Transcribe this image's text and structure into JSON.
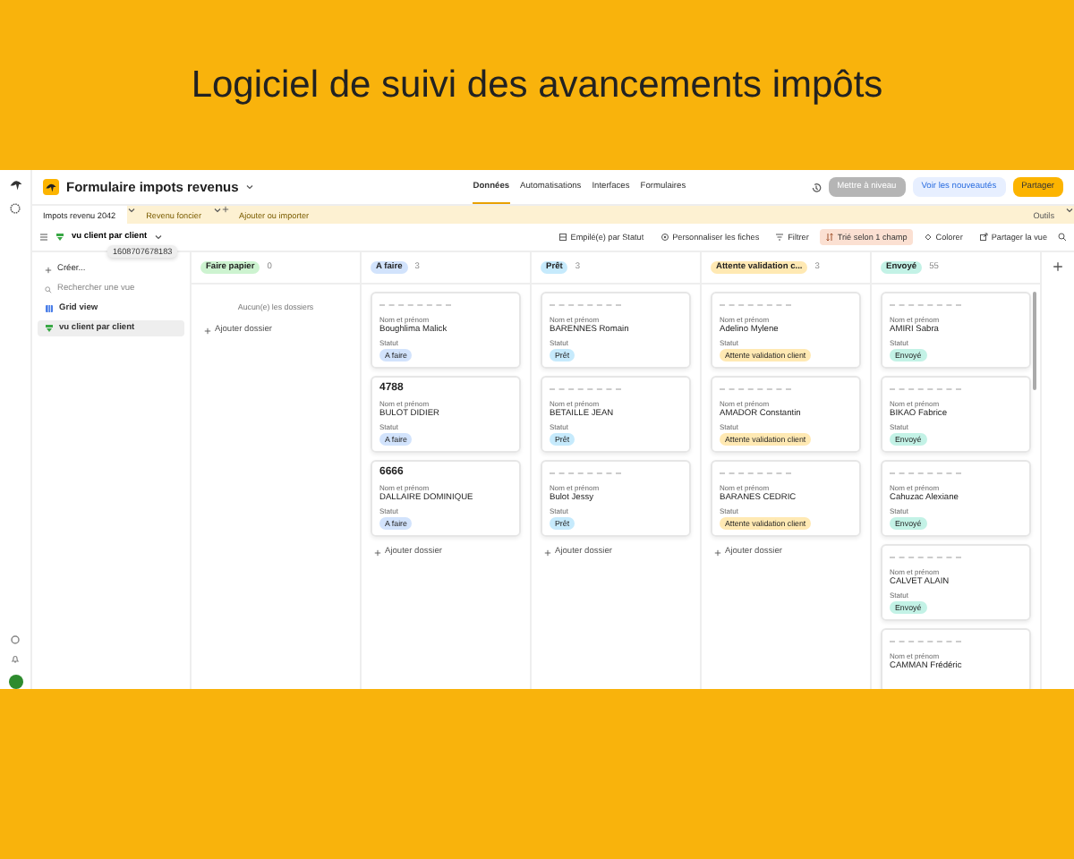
{
  "banner": {
    "title": "Logiciel de suivi des avancements impôts"
  },
  "app": {
    "base_title": "Formulaire impots revenus",
    "nav": [
      {
        "label": "Données",
        "selected": true
      },
      {
        "label": "Automatisations",
        "selected": false
      },
      {
        "label": "Interfaces",
        "selected": false
      },
      {
        "label": "Formulaires",
        "selected": false
      }
    ],
    "actions": [
      {
        "label": "Mettre à niveau",
        "kind": "upgrade"
      },
      {
        "label": "Voir les nouveautés",
        "kind": "news"
      },
      {
        "label": "Partager",
        "kind": "share"
      }
    ],
    "tables": [
      {
        "label": "Impots revenu 2042",
        "selected": true
      },
      {
        "label": "Revenu foncier",
        "selected": false
      }
    ],
    "add_table": "Ajouter ou importer",
    "tools": "Outils",
    "view": {
      "name": "vu client par client",
      "tooltip": "1608707678183"
    },
    "toolbar": [
      {
        "label": "Empilé(e) par Statut",
        "kind": "stack",
        "highlighted": false
      },
      {
        "label": "Personnaliser les fiches",
        "kind": "customize",
        "highlighted": false
      },
      {
        "label": "Filtrer",
        "kind": "filter",
        "highlighted": false
      },
      {
        "label": "Trié selon 1 champ",
        "kind": "sort",
        "highlighted": true
      },
      {
        "label": "Colorer",
        "kind": "color",
        "highlighted": false
      },
      {
        "label": "Partager la vue",
        "kind": "share",
        "highlighted": false
      }
    ],
    "sidebar": {
      "create": "Créer...",
      "search_placeholder": "Rechercher une vue",
      "views": [
        {
          "label": "Grid view",
          "kind": "grid",
          "selected": false
        },
        {
          "label": "vu client par client",
          "kind": "kanban",
          "selected": true
        }
      ]
    },
    "columns": [
      {
        "label": "Faire papier",
        "count": "0",
        "color": "#cdf3d0",
        "empty_text": "Aucun(e) les dossiers",
        "add_label": "Ajouter dossier"
      },
      {
        "label": "A faire",
        "count": "3",
        "color": "#d2e3fc",
        "add_label": "Ajouter dossier",
        "cards": [
          {
            "name_label": "Nom et prénom",
            "name": "Boughlima Malick",
            "status_label": "Statut",
            "status": "A faire"
          },
          {
            "title": "4788",
            "name_label": "Nom et prénom",
            "name": "BULOT DIDIER",
            "status_label": "Statut",
            "status": "A faire"
          },
          {
            "title": "6666",
            "name_label": "Nom et prénom",
            "name": "DALLAIRE DOMINIQUE",
            "status_label": "Statut",
            "status": "A faire"
          }
        ]
      },
      {
        "label": "Prêt",
        "count": "3",
        "color": "#c6eafc",
        "add_label": "Ajouter dossier",
        "cards": [
          {
            "name_label": "Nom et prénom",
            "name": "BARENNES Romain",
            "status_label": "Statut",
            "status": "Prêt"
          },
          {
            "name_label": "Nom et prénom",
            "name": "BETAILLE JEAN",
            "status_label": "Statut",
            "status": "Prêt"
          },
          {
            "name_label": "Nom et prénom",
            "name": "Bulot Jessy",
            "status_label": "Statut",
            "status": "Prêt"
          }
        ]
      },
      {
        "label": "Attente validation c...",
        "count": "3",
        "color": "#ffe9b3",
        "add_label": "Ajouter dossier",
        "cards": [
          {
            "name_label": "Nom et prénom",
            "name": "Adelino Mylene",
            "status_label": "Statut",
            "status": "Attente validation client"
          },
          {
            "name_label": "Nom et prénom",
            "name": "AMADOR Constantin",
            "status_label": "Statut",
            "status": "Attente validation client"
          },
          {
            "name_label": "Nom et prénom",
            "name": "BARANES CEDRIC",
            "status_label": "Statut",
            "status": "Attente validation client"
          }
        ]
      },
      {
        "label": "Envoyé",
        "count": "55",
        "color": "#c3f2e6",
        "cards": [
          {
            "name_label": "Nom et prénom",
            "name": "AMIRI Sabra",
            "status_label": "Statut",
            "status": "Envoyé"
          },
          {
            "name_label": "Nom et prénom",
            "name": "BIKAO Fabrice",
            "status_label": "Statut",
            "status": "Envoyé"
          },
          {
            "name_label": "Nom et prénom",
            "name": "Cahuzac Alexiane",
            "status_label": "Statut",
            "status": "Envoyé"
          },
          {
            "name_label": "Nom et prénom",
            "name": "CALVET ALAIN",
            "status_label": "Statut",
            "status": "Envoyé"
          },
          {
            "name_label": "Nom et prénom",
            "name": "CAMMAN Frédéric"
          }
        ]
      }
    ]
  }
}
